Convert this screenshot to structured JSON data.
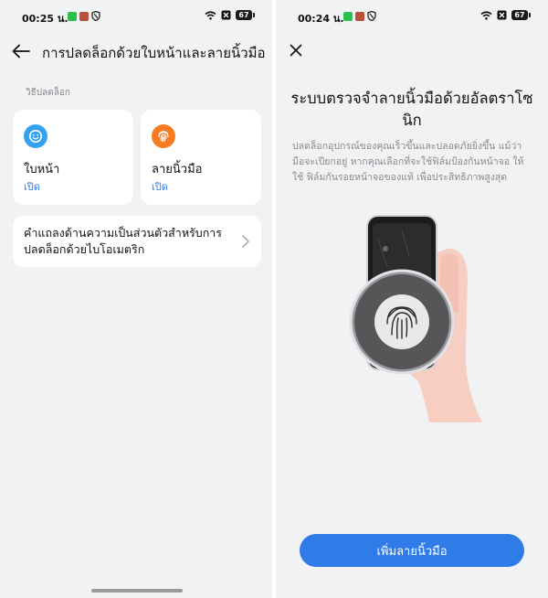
{
  "colors": {
    "accent": "#2f7be8",
    "face_icon": "#35a2ef",
    "fingerprint_icon": "#f57c23",
    "background": "#f1f2f4"
  },
  "left_screen": {
    "status_bar": {
      "time": "00:25 น.",
      "battery": "67"
    },
    "header": {
      "back_icon": "arrow-left-icon",
      "title": "การปลดล็อกด้วยใบหน้าและลายนิ้วมือ"
    },
    "section_label": "วิธีปลดล็อก",
    "cards": [
      {
        "icon": "face-icon",
        "title": "ใบหน้า",
        "status": "เปิด"
      },
      {
        "icon": "fingerprint-icon",
        "title": "ลายนิ้วมือ",
        "status": "เปิด"
      }
    ],
    "privacy_item": {
      "label": "คำแถลงด้านความเป็นส่วนตัวสำหรับการปลดล็อกด้วยไบโอเมตริก",
      "icon": "chevron-right-icon"
    }
  },
  "right_screen": {
    "status_bar": {
      "time": "00:24 น.",
      "battery": "67"
    },
    "close_icon": "close-icon",
    "title": "ระบบตรวจจำลายนิ้วมือด้วยอัลตราโซนิก",
    "description": "ปลดล็อกอุปกรณ์ของคุณเร็วขึ้นและปลอดภัยยิ่งขึ้น แม้ว่ามือจะเปียกอยู่ หากคุณเลือกที่จะใช้ฟิล์มป้องกันหน้าจอ ให้ใช้ ฟิล์มกันรอยหน้าจอของแท้ เพื่อประสิทธิภาพสูงสุด",
    "illustration_icon": "hand-phone-fingerprint-illustration",
    "primary_button": "เพิ่มลายนิ้วมือ"
  }
}
